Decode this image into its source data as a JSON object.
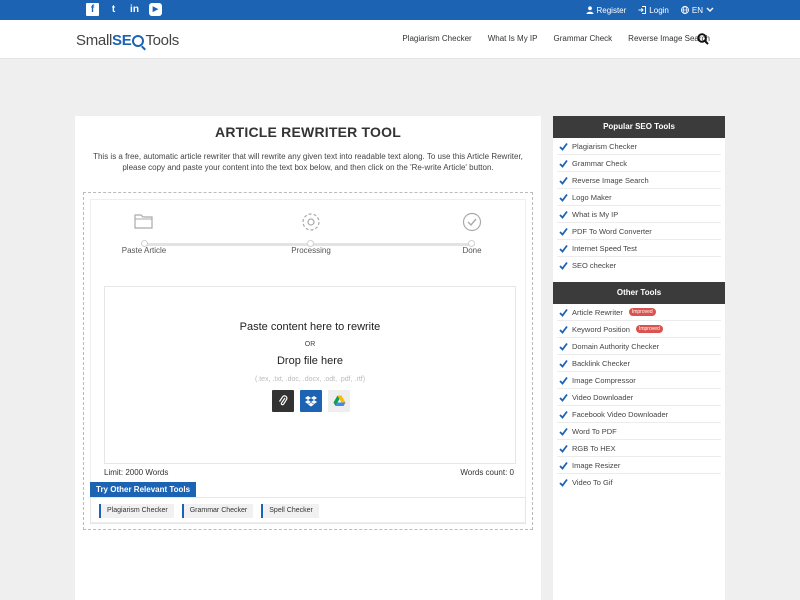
{
  "topbar": {
    "register": "Register",
    "login": "Login",
    "language": "EN"
  },
  "header": {
    "logo": {
      "part1": "Small",
      "part2": "SE",
      "part3": "Tools"
    },
    "nav": [
      "Plagiarism Checker",
      "What Is My IP",
      "Grammar Check",
      "Reverse Image Search"
    ]
  },
  "main": {
    "title": "ARTICLE REWRITER TOOL",
    "description": "This is a free, automatic article rewriter that will rewrite any given text into readable text along. To use this Article Rewriter, please copy and paste your content into the text box below, and then click on the 'Re-write Article' button.",
    "steps": [
      "Paste Article",
      "Processing",
      "Done"
    ],
    "drop": {
      "paste_text": "Paste content here to rewrite",
      "or_text": "OR",
      "drop_text": "Drop file here",
      "extensions": "(.tex, .txt, .doc, .docx, .odt, .pdf, .rtf)"
    },
    "limit": "Limit: 2000 Words",
    "word_count": "Words count: 0",
    "try_other": {
      "label": "Try Other Relevant Tools",
      "chips": [
        "Plagiarism Checker",
        "Grammar Checker",
        "Spell Checker"
      ]
    }
  },
  "sidebar": {
    "popular_title": "Popular SEO Tools",
    "popular": [
      "Plagiarism Checker",
      "Grammar Check",
      "Reverse Image Search",
      "Logo Maker",
      "What is My IP",
      "PDF To Word Converter",
      "Internet Speed Test",
      "SEO checker"
    ],
    "other_title": "Other Tools",
    "other": [
      {
        "label": "Article Rewriter",
        "badge": "Improved"
      },
      {
        "label": "Keyword Position",
        "badge": "Improved"
      },
      {
        "label": "Domain Authority Checker",
        "badge": ""
      },
      {
        "label": "Backlink Checker",
        "badge": ""
      },
      {
        "label": "Image Compressor",
        "badge": ""
      },
      {
        "label": "Video Downloader",
        "badge": ""
      },
      {
        "label": "Facebook Video Downloader",
        "badge": ""
      },
      {
        "label": "Word To PDF",
        "badge": ""
      },
      {
        "label": "RGB To HEX",
        "badge": ""
      },
      {
        "label": "Image Resizer",
        "badge": ""
      },
      {
        "label": "Video To Gif",
        "badge": ""
      }
    ]
  },
  "colors": {
    "brand": "#1d63b4",
    "dark": "#3b3b3b",
    "badge": "#d9534f"
  }
}
